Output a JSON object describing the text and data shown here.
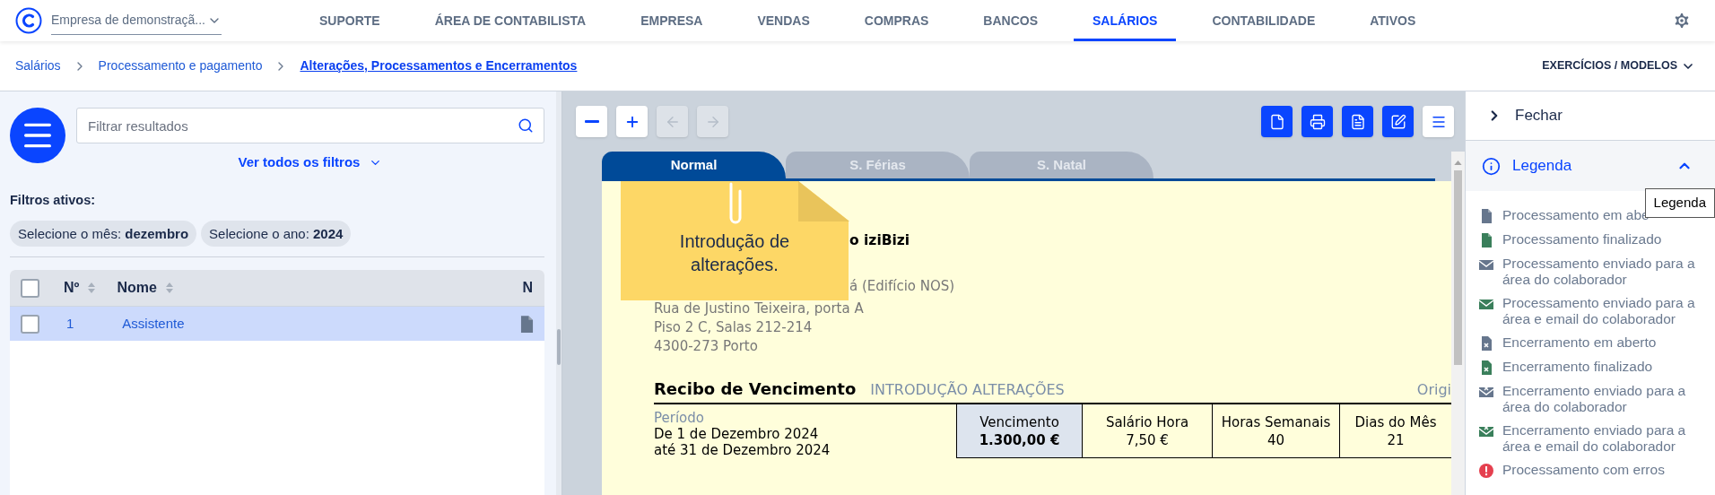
{
  "header": {
    "company": "Empresa de demonstraçã...",
    "nav": [
      {
        "label": "SUPORTE",
        "selected": false
      },
      {
        "label": "ÁREA DE CONTABILISTA",
        "selected": false
      },
      {
        "label": "EMPRESA",
        "selected": false
      },
      {
        "label": "VENDAS",
        "selected": false
      },
      {
        "label": "COMPRAS",
        "selected": false
      },
      {
        "label": "BANCOS",
        "selected": false
      },
      {
        "label": "SALÁRIOS",
        "selected": true
      },
      {
        "label": "CONTABILIDADE",
        "selected": false
      },
      {
        "label": "ATIVOS",
        "selected": false
      }
    ]
  },
  "breadcrumb": [
    "Salários",
    "Processamento e pagamento",
    "Alterações, Processamentos e Encerramentos"
  ],
  "exercises_menu": "EXERCÍCIOS / MODELOS",
  "filters": {
    "search": {
      "placeholder": "Filtrar resultados"
    },
    "show_all": "Ver todos os filtros",
    "active_title": "Filtros ativos:",
    "chips": [
      "Selecione o mês: **dezembro**",
      "Selecione o ano: **2024**"
    ]
  },
  "table": {
    "header_checked": false,
    "columns": [
      "Nº",
      "Nome",
      "N"
    ],
    "rows": [
      {
        "number": "1",
        "name": "Assistente",
        "checked": false,
        "selected": true
      }
    ]
  },
  "viewer": {
    "tools": [
      {
        "kind": "zoom-out",
        "disabled": false
      },
      {
        "kind": "zoom-in",
        "disabled": false
      },
      {
        "kind": "back",
        "disabled": true
      },
      {
        "kind": "forward",
        "disabled": true
      }
    ],
    "actions": [
      {
        "kind": "new-file"
      },
      {
        "kind": "print"
      },
      {
        "kind": "pdf"
      },
      {
        "kind": "edit"
      },
      {
        "kind": "menu"
      }
    ],
    "tabs": [
      {
        "label": "Normal",
        "selected": true
      },
      {
        "label": "S. Férias",
        "selected": false
      },
      {
        "label": "S. Natal",
        "selected": false
      }
    ],
    "note": "Introdução de alterações.",
    "document": {
      "company": "o iziBizi",
      "address_hidden_part": "á (Edifício NOS)",
      "address": [
        "Rua de Justino Teixeira, porta A",
        "Piso 2 C, Salas 212-214",
        "4300-273 Porto"
      ],
      "title": "Recibo de Vencimento",
      "subtitle": "INTRODUÇÃO ALTERAÇÕES",
      "original": "Origi",
      "period_label": "Período",
      "period": [
        "De 1 de Dezembro 2024",
        "até 31 de Dezembro 2024"
      ],
      "summary": [
        {
          "label": "Vencimento",
          "value": "1.300,00 €",
          "highlighted": true
        },
        {
          "label": "Salário Hora",
          "value": "7,50 €",
          "highlighted": false
        },
        {
          "label": "Horas Semanais",
          "value": "40",
          "highlighted": false
        },
        {
          "label": "Dias do Mês",
          "value": "21",
          "highlighted": false
        }
      ]
    }
  },
  "panel": {
    "close": "Fechar",
    "legend": {
      "title": "Legenda",
      "expanded": true,
      "tooltip": "Legenda",
      "items": [
        {
          "kind": "file",
          "color": "#66768d",
          "label": "Processamento em abe"
        },
        {
          "kind": "file",
          "color": "#3a7f5b",
          "label": "Processamento finalizado"
        },
        {
          "kind": "mail",
          "color": "#66768d",
          "label": "Processamento enviado para a área do colaborador"
        },
        {
          "kind": "mail",
          "color": "#3a7f5b",
          "label": "Processamento enviado para a área e email do colaborador"
        },
        {
          "kind": "file-x",
          "color": "#66768d",
          "label": "Encerramento em aberto"
        },
        {
          "kind": "file-x",
          "color": "#3a7f5b",
          "label": "Encerramento finalizado"
        },
        {
          "kind": "mail-x",
          "color": "#66768d",
          "label": "Encerramento enviado para a área do colaborador"
        },
        {
          "kind": "mail-x",
          "color": "#3a7f5b",
          "label": "Encerramento enviado para a área e email do colaborador"
        },
        {
          "kind": "alert",
          "color": "#e5404f",
          "label": "Processamento com erros"
        }
      ]
    }
  }
}
